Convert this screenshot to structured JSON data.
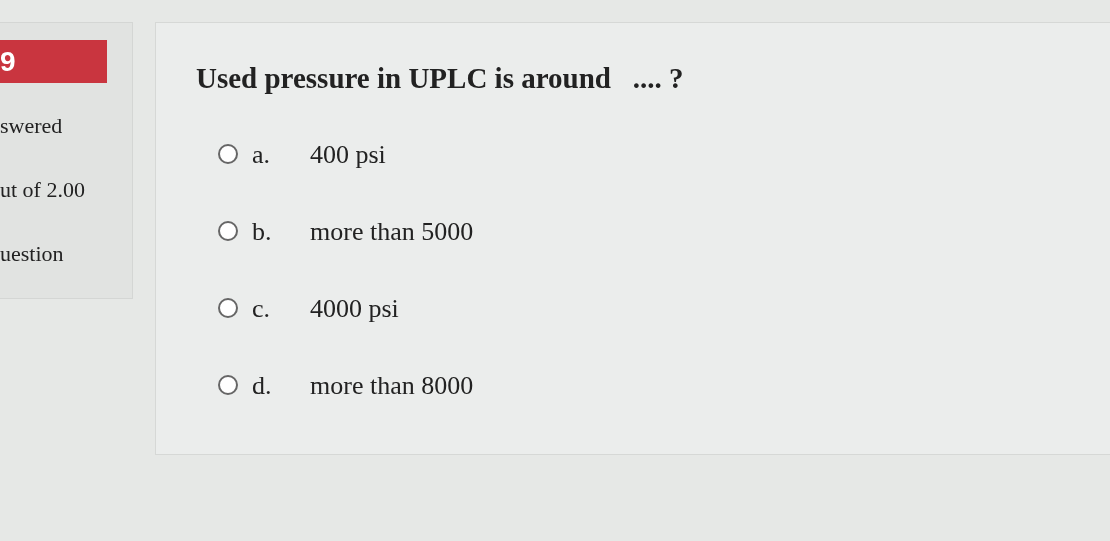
{
  "info": {
    "number": "9",
    "status": "swered",
    "mark": "ut of 2.00",
    "flag": "uestion"
  },
  "question": {
    "text": "Used pressure in UPLC is around   .... ?"
  },
  "options": [
    {
      "letter": "a.",
      "text": "400 psi",
      "selected": false
    },
    {
      "letter": "b.",
      "text": "more than 5000",
      "selected": false
    },
    {
      "letter": "c.",
      "text": "4000 psi",
      "selected": false
    },
    {
      "letter": "d.",
      "text": "more than 8000",
      "selected": false
    }
  ]
}
